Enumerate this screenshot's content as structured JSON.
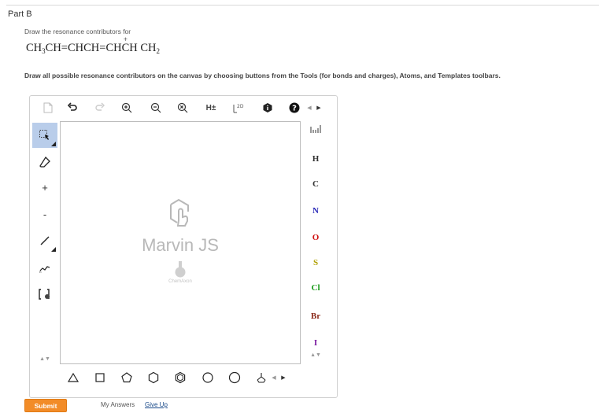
{
  "part_title": "Part B",
  "prompt": "Draw the resonance contributors for",
  "formula": {
    "seg1": "CH",
    "sub1": "3",
    "seg2": "CH=CHCH=CH",
    "c_plus": "C",
    "plus": "+",
    "seg3": "H",
    "seg4": "CH",
    "sub2": "2"
  },
  "instruction": "Draw all possible resonance contributors on the canvas by choosing buttons from the Tools (for bonds and charges), Atoms, and Templates toolbars.",
  "toolbar": {
    "h_label": "H±",
    "dim_label": "2D",
    "help_label": "?"
  },
  "left_tools": {
    "plus_label": "+",
    "minus_label": "-"
  },
  "watermark": {
    "title": "Marvin JS",
    "subtitle": "ChemAxon"
  },
  "atoms": [
    {
      "symbol": "H",
      "color": "#333333"
    },
    {
      "symbol": "C",
      "color": "#333333"
    },
    {
      "symbol": "N",
      "color": "#2a2ab8"
    },
    {
      "symbol": "O",
      "color": "#d01010"
    },
    {
      "symbol": "S",
      "color": "#b0a000"
    },
    {
      "symbol": "Cl",
      "color": "#1a9a1a"
    },
    {
      "symbol": "Br",
      "color": "#8a2a1a"
    },
    {
      "symbol": "I",
      "color": "#7a1aa0"
    }
  ],
  "buttons": {
    "submit": "Submit",
    "my_answers": "My Answers",
    "give_up": "Give Up"
  },
  "colors": {
    "accent": "#f28c28",
    "active_tool": "#b9cdea",
    "link": "#1a4a8a"
  }
}
